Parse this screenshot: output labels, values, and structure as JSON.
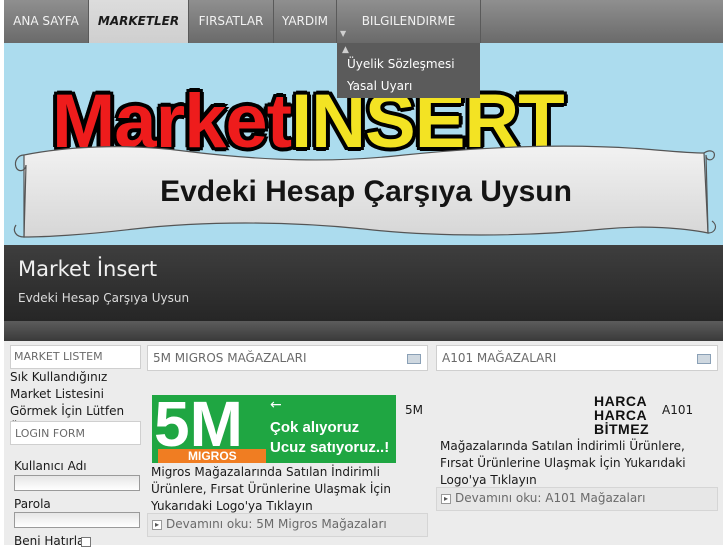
{
  "nav": {
    "items": [
      {
        "label": "ANA SAYFA"
      },
      {
        "label": "MARKETLER"
      },
      {
        "label": "FIRSATLAR"
      },
      {
        "label": "YARDIM"
      },
      {
        "label": "BILGILENDIRME"
      }
    ],
    "dropdown": [
      "Üyelik Sözleşmesi",
      "Yasal Uyarı"
    ]
  },
  "banner": {
    "logo_part1": "Market",
    "logo_part2": "INSERT",
    "slogan": "Evdeki Hesap Çarşıya Uysun"
  },
  "header": {
    "title": "Market İnsert",
    "subtitle": "Evdeki Hesap Çarşıya Uysun"
  },
  "sidebar": {
    "market_list": {
      "title": "MARKET LISTEM",
      "text": "Sık Kullandığınız Market Listesini Görmek İçin Lütfen Üye Girişi Yapın"
    },
    "login": {
      "title": "LOGIN FORM",
      "username_label": "Kullanıcı Adı",
      "username_value": "",
      "password_label": "Parola",
      "password_value": "",
      "remember_label": "Beni Hatırla"
    }
  },
  "articles": [
    {
      "title": "5M MIGROS MAĞAZALARI",
      "logo_big": "5M",
      "logo_brand": "MIGROS",
      "logo_tag1": "Çok alıyoruz",
      "logo_tag2": "Ucuz satıyoruz..!",
      "lead": "5M",
      "body": "Migros  Mağazalarında Satılan İndirimli Ürünlere, Fırsat Ürünlerine Ulaşmak İçin Yukarıdaki Logo'ya Tıklayın",
      "readmore": "Devamını oku: 5M Migros Mağazaları"
    },
    {
      "title": "A101 MAĞAZALARI",
      "logo_lines": [
        "HARCA",
        "HARCA",
        "BİTMEZ"
      ],
      "lead": "A101",
      "body": "Mağazalarında Satılan İndirimli Ürünlere, Fırsat Ürünlerine Ulaşmak İçin Yukarıdaki Logo'ya Tıklayın",
      "readmore": "Devamını oku: A101 Mağazaları"
    }
  ],
  "colors": {
    "banner_bg": "#acdcee",
    "logo_red": "#ee1c1c",
    "logo_yellow": "#f3e323",
    "migros_green": "#1fa642",
    "header_bg": "#2e2e2e"
  }
}
